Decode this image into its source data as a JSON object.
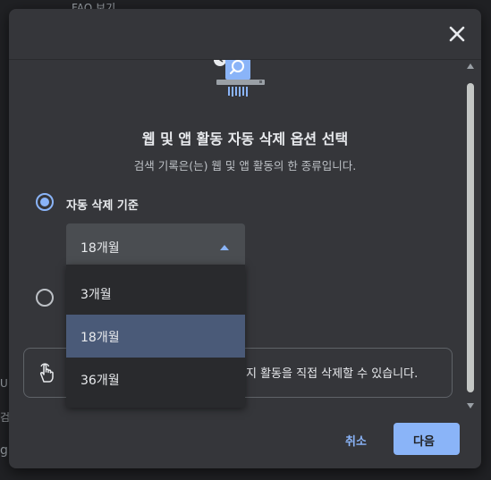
{
  "background": {
    "top_text": "FAQ 보기",
    "left_text_1": "U",
    "left_text_2": "검",
    "left_text_3": "g"
  },
  "dialog": {
    "title": "웹 및 앱 활동 자동 삭제 옵션 선택",
    "subtitle": "검색 기록은(는) 웹 및 앱 활동의 한 종류입니다.",
    "option_auto_delete_label": "자동 삭제 기준",
    "select_value": "18개월",
    "dropdown_options": [
      "3개월",
      "18개월",
      "36개월"
    ],
    "selected_option": "18개월",
    "info_text": "지 활동을 직접 삭제할 수 있습니다.",
    "cancel_label": "취소",
    "next_label": "다음",
    "icons": [
      "close-icon",
      "shredder-search-icon",
      "hand-pointer-icon"
    ],
    "accent_color": "#8ab4f8"
  }
}
